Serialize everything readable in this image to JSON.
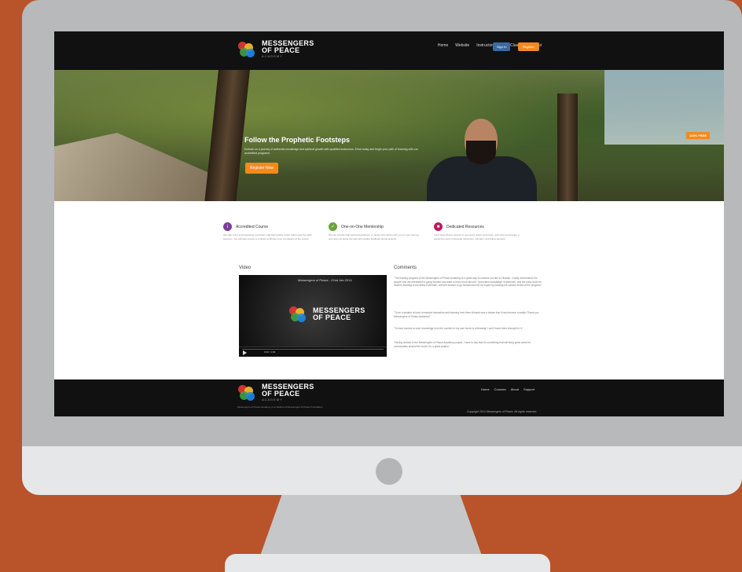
{
  "colors": {
    "background": "#b9532a",
    "accent": "#f28a1e",
    "signin": "#3b6aa0",
    "nav_bg": "#111111"
  },
  "header": {
    "logo_line1": "MESSENGERS",
    "logo_line2": "OF PEACE",
    "logo_sub": "ACADEMY",
    "nav": [
      "Home",
      "Website",
      "Instructors",
      "Live Classes",
      "About"
    ],
    "signin_label": "Sign In",
    "register_label": "Register"
  },
  "hero": {
    "title": "Follow the Prophetic Footsteps",
    "text": "Embark on a journey of authentic knowledge and spiritual growth with qualified instructors. Enrol today and begin your path of learning with our accredited programs.",
    "button_label": "Register Now",
    "badge": "100% FREE"
  },
  "features": [
    {
      "title": "Accredited Course",
      "icon": "graduation-icon",
      "color": "#7b3f98",
      "desc": "We offer a fun and interesting curriculum with high quality online videos and live Q&A sessions. You will also receive a certified certificate upon completion of the course."
    },
    {
      "title": "One-on-One Mentorship",
      "icon": "check-icon",
      "color": "#6aa23a",
      "desc": "We can provide high personal guidance: a mentor who will be with you on your journey and help you along the way with regular feedback during lessons."
    },
    {
      "title": "Dedicated Resources",
      "icon": "book-icon",
      "color": "#c2185b",
      "desc": "You'll have lifetime access to resources videos and notes, and more importantly, a supportive team of devoted instructors, scholars, and fellow learners."
    }
  ],
  "video": {
    "label": "Video",
    "title": "Messengers of Peace - 22nd Jan 2014",
    "time": "0:00 / 1:00"
  },
  "comments": {
    "label": "Comments",
    "items": [
      "\"The training program of the Messengers of Peace Academy is a great way to connect our ties to Hismah. I really recommend it to people who are interested in going forward and want to learn more about it. It provides knowledge, experience, and the basic tools for modern learning in the fields of Ahmiah, with the chance to go forward and be an expert by passing the various levels of the program.\"",
      "\"To be a student of such renowned instructors and learning from them Ahmiah was a dream that it has become a reality! Thank you Messengers of Peace Academy!\"",
      "\"To have access to such knowledge from the comfort of my own home is a blessing! I can't thank them enough for it.\"",
      "\"Having worked in the Messengers of Peace Academy project, I have to say that it's something that will bring great value for communities around the world. It's a great project.\""
    ]
  },
  "footer": {
    "links": [
      "Home",
      "Courses",
      "About",
      "Support"
    ],
    "tagline": "Messengers of Peace Academy is a initiative of Messengers of Peace Foundation",
    "copyright": "Copyright 2014 Messengers of Peace. All rights reserved."
  }
}
